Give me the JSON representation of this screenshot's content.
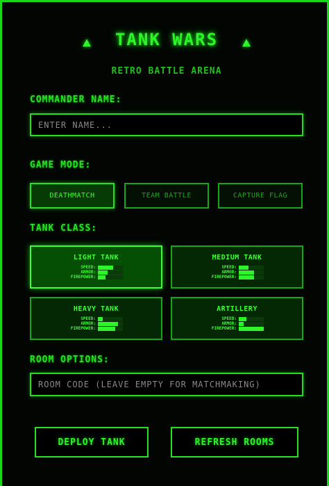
{
  "header": {
    "title": "TANK WARS",
    "subtitle": "RETRO BATTLE ARENA"
  },
  "commander": {
    "label": "COMMANDER NAME:",
    "placeholder": "ENTER NAME...",
    "value": ""
  },
  "game_mode": {
    "label": "GAME MODE:",
    "options": [
      {
        "label": "DEATHMATCH",
        "selected": true
      },
      {
        "label": "TEAM BATTLE",
        "selected": false
      },
      {
        "label": "CAPTURE FLAG",
        "selected": false
      }
    ]
  },
  "tank_class": {
    "label": "TANK CLASS:",
    "stat_labels": {
      "speed": "SPEED:",
      "armor": "ARMOR:",
      "firepower": "FIREPOWER:"
    },
    "classes": [
      {
        "name": "LIGHT TANK",
        "selected": true,
        "speed": 0.6,
        "armor": 0.4,
        "firepower": 0.3
      },
      {
        "name": "MEDIUM TANK",
        "selected": false,
        "speed": 0.4,
        "armor": 0.6,
        "firepower": 0.6
      },
      {
        "name": "HEAVY TANK",
        "selected": false,
        "speed": 0.2,
        "armor": 0.8,
        "firepower": 0.7
      },
      {
        "name": "ARTILLERY",
        "selected": false,
        "speed": 0.3,
        "armor": 0.2,
        "firepower": 1.0
      }
    ]
  },
  "room": {
    "label": "ROOM OPTIONS:",
    "placeholder": "ROOM CODE (LEAVE EMPTY FOR MATCHMAKING)",
    "value": ""
  },
  "actions": {
    "deploy_label": "DEPLOY TANK",
    "refresh_label": "REFRESH ROOMS"
  },
  "colors": {
    "accent": "#22e01e",
    "background": "#000000",
    "selected_bg": "#054f05"
  }
}
